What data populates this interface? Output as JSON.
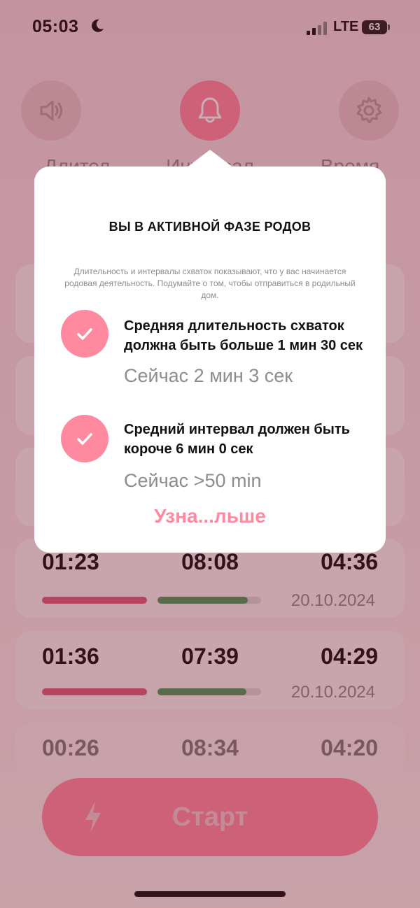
{
  "status_bar": {
    "time": "05:03",
    "network": "LTE",
    "battery": "63"
  },
  "controls": [
    {
      "icon": "speaker-icon",
      "label": "Длител"
    },
    {
      "icon": "bell-icon",
      "label": "Интервал"
    },
    {
      "icon": "gear-icon",
      "label": "Время"
    }
  ],
  "modal": {
    "title": "ВЫ В АКТИВНОЙ ФАЗЕ РОДОВ",
    "description": "Длительность и интервалы схваток показывают, что у вас начинается родовая деятельность. Подумайте о том, чтобы отправиться в родильный дом.",
    "criteria": [
      {
        "text": "Средняя длительность схваток должна быть больше 1 мин 30 сек",
        "current": "Сейчас 2 мин 3 сек"
      },
      {
        "text": "Средний интервал должен быть короче 6 мин 0 сек",
        "current": "Сейчас >50 min"
      }
    ],
    "learn_more": "Узна...льше"
  },
  "records": [
    {
      "duration": "01:23",
      "interval": "08:08",
      "time": "04:36",
      "date": "20.10.2024",
      "duration_fill": 1.0,
      "interval_fill": 0.87
    },
    {
      "duration": "01:36",
      "interval": "07:39",
      "time": "04:29",
      "date": "20.10.2024",
      "duration_fill": 1.0,
      "interval_fill": 0.86
    },
    {
      "duration": "00:26",
      "interval": "08:34",
      "time": "04:20"
    }
  ],
  "start_label": "Старт",
  "colors": {
    "accent": "#ff8aa0",
    "duration_bar": "#e0607c",
    "interval_bar": "#4f9a5a"
  }
}
